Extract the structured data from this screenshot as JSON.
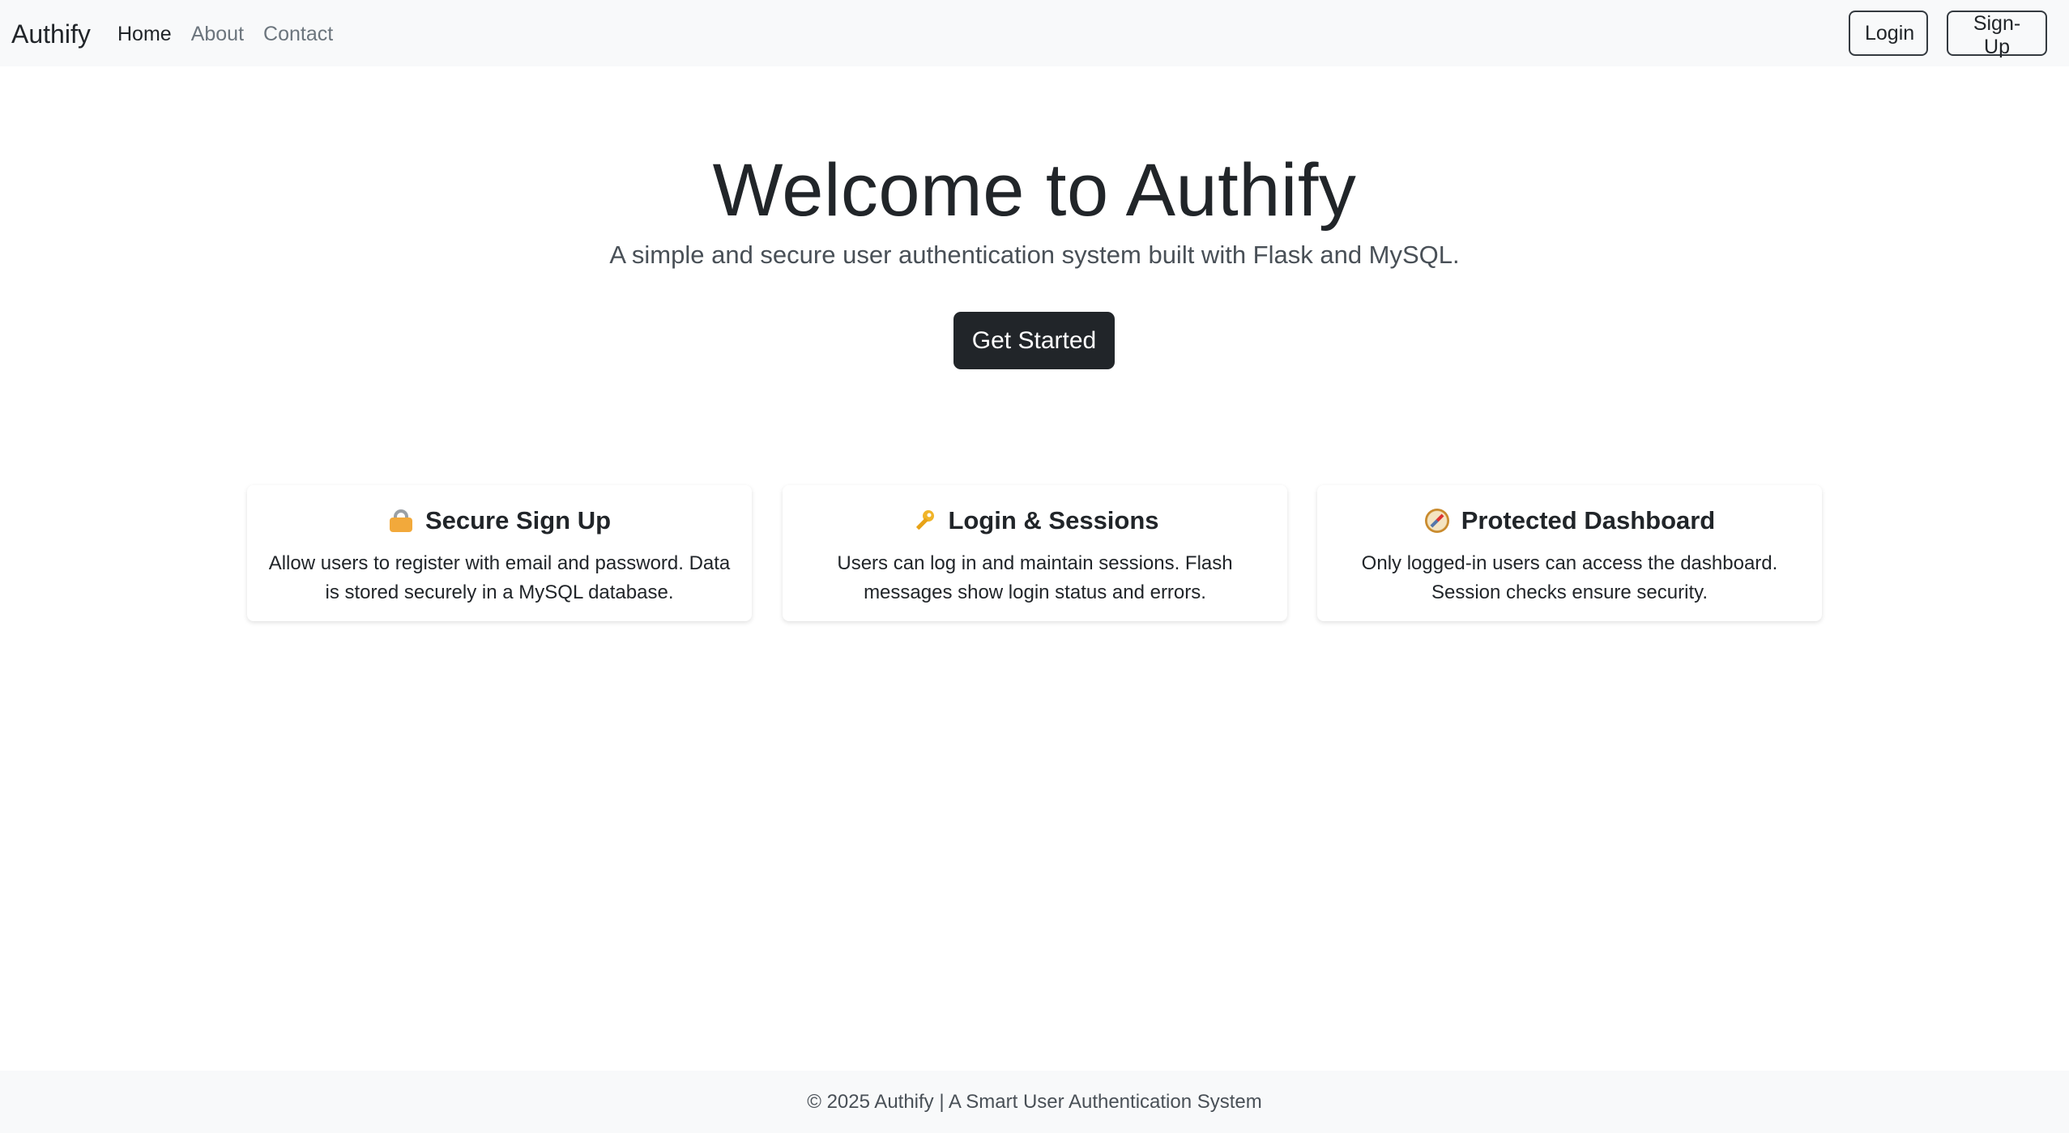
{
  "navbar": {
    "brand": "Authify",
    "links": [
      {
        "label": "Home",
        "active": true
      },
      {
        "label": "About",
        "active": false
      },
      {
        "label": "Contact",
        "active": false
      }
    ],
    "login_label": "Login",
    "signup_label": "Sign-Up"
  },
  "hero": {
    "title": "Welcome to Authify",
    "subtitle": "A simple and secure user authentication system built with Flask and MySQL.",
    "cta_label": "Get Started"
  },
  "features": [
    {
      "icon": "lock-icon",
      "title": "Secure Sign Up",
      "text": "Allow users to register with email and password. Data is stored securely in a MySQL database."
    },
    {
      "icon": "key-icon",
      "title": "Login & Sessions",
      "text": "Users can log in and maintain sessions. Flash messages show login status and errors."
    },
    {
      "icon": "compass-icon",
      "title": "Protected Dashboard",
      "text": "Only logged-in users can access the dashboard. Session checks ensure security."
    }
  ],
  "footer": {
    "text": "© 2025 Authify | A Smart User Authentication System"
  },
  "colors": {
    "navbar_bg": "#f8f9fa",
    "cta_bg": "#212529",
    "text": "#212529",
    "muted": "#6c757d"
  }
}
